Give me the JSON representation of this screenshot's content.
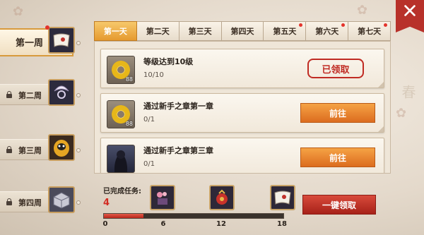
{
  "weeks": [
    {
      "label": "第一周",
      "active": true,
      "locked": false
    },
    {
      "label": "第二周",
      "active": false,
      "locked": true
    },
    {
      "label": "第三周",
      "active": false,
      "locked": true
    },
    {
      "label": "第四周",
      "active": false,
      "locked": true
    }
  ],
  "tabs": [
    {
      "label": "第一天",
      "active": true,
      "badge": false
    },
    {
      "label": "第二天",
      "active": false,
      "badge": false
    },
    {
      "label": "第三天",
      "active": false,
      "badge": false
    },
    {
      "label": "第四天",
      "active": false,
      "badge": false
    },
    {
      "label": "第五天",
      "active": false,
      "badge": true
    },
    {
      "label": "第六天",
      "active": false,
      "badge": true
    },
    {
      "label": "第七天",
      "active": false,
      "badge": true
    }
  ],
  "tasks": [
    {
      "title": "等级达到10级",
      "progress": "10/10",
      "reward_count": "88",
      "reward_icon": "coin-icon",
      "status": "已领取",
      "state": "claimed"
    },
    {
      "title": "通过新手之章第一章",
      "progress": "0/1",
      "reward_count": "88",
      "reward_icon": "coin-icon",
      "status": "前往",
      "state": "goto"
    },
    {
      "title": "通过新手之章第三章",
      "progress": "0/1",
      "reward_count": "",
      "reward_icon": "character-icon",
      "status": "前往",
      "state": "goto"
    }
  ],
  "summary": {
    "label": "已完成任务:",
    "count": "4",
    "progress": 4,
    "max": 18,
    "ticks": [
      "0",
      "6",
      "12",
      "18"
    ]
  },
  "rewards": [
    {
      "icon": "flower-box-icon"
    },
    {
      "icon": "red-pouch-icon"
    },
    {
      "icon": "letter-icon"
    }
  ],
  "one_key_label": "一键领取",
  "close_icon": "close-icon",
  "decor_text": "春",
  "colors": {
    "accent": "#e59a2f",
    "button": "#dc6c1f",
    "claim_red": "#c02b23",
    "progress_red": "#b8261c"
  }
}
